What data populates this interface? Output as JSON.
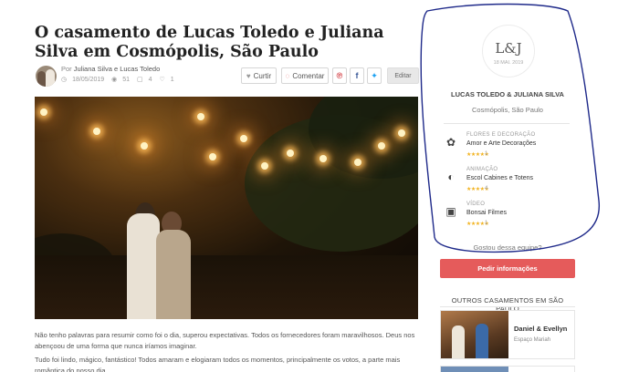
{
  "article": {
    "title": "O casamento de Lucas Toledo e Juliana Silva em Cosmópolis, São Paulo",
    "by_prefix": "Por",
    "authors": "Juliana Silva e Lucas Toledo",
    "date": "18/05/2019",
    "views": "51",
    "comments": "4",
    "likes": "1",
    "actions": {
      "like": "Curtir",
      "comment": "Comentar",
      "edit": "Editar"
    },
    "paragraphs": [
      "Não tenho palavras para resumir como foi o dia, superou expectativas. Todos os fornecedores foram maravilhosos. Deus nos abençoou de uma forma que nunca iríamos imaginar.",
      "Tudo foi lindo, mágico, fantástico! Todos amaram e elogiaram todos os momentos, principalmente os votos, a parte mais romântica do nosso dia."
    ]
  },
  "icons": {
    "calendar": "calendar-icon",
    "eye": "eye-icon",
    "comment": "comment-icon",
    "heart": "heart-icon",
    "pinterest": "pinterest-icon",
    "facebook": "facebook-icon",
    "twitter": "twitter-icon",
    "flower": "flower-icon",
    "mask": "mask-icon",
    "camera": "video-camera-icon"
  },
  "sidebar": {
    "monogram": "L&J",
    "wedding_date": "18 MAI. 2019",
    "couple": "LUCAS TOLEDO & JULIANA SILVA",
    "location": "Cosmópolis, São Paulo",
    "vendors": [
      {
        "category": "FLORES E DECORAÇÃO",
        "name": "Amor e Arte Decorações",
        "stars": "★★★★★",
        "rating": 5,
        "reviews": "1"
      },
      {
        "category": "ANIMAÇÃO",
        "name": "Escol Cabines e Totens",
        "stars": "★★★★★",
        "rating": 5,
        "reviews": "4"
      },
      {
        "category": "VÍDEO",
        "name": "Bonsai Filmes",
        "stars": "★★★★★",
        "rating": 5,
        "reviews": "1"
      }
    ],
    "cta_question": "Gostou dessa equipe?",
    "cta_button": "Pedir informações",
    "others_title": "OUTROS CASAMENTOS EM SÃO PAULO",
    "others": [
      {
        "names": "Daniel & Evellyn",
        "venue": "Espaço Mariah"
      }
    ]
  },
  "colors": {
    "accent": "#e55b5b",
    "stars": "#f2b320",
    "annotation": "#1f2a8a"
  }
}
